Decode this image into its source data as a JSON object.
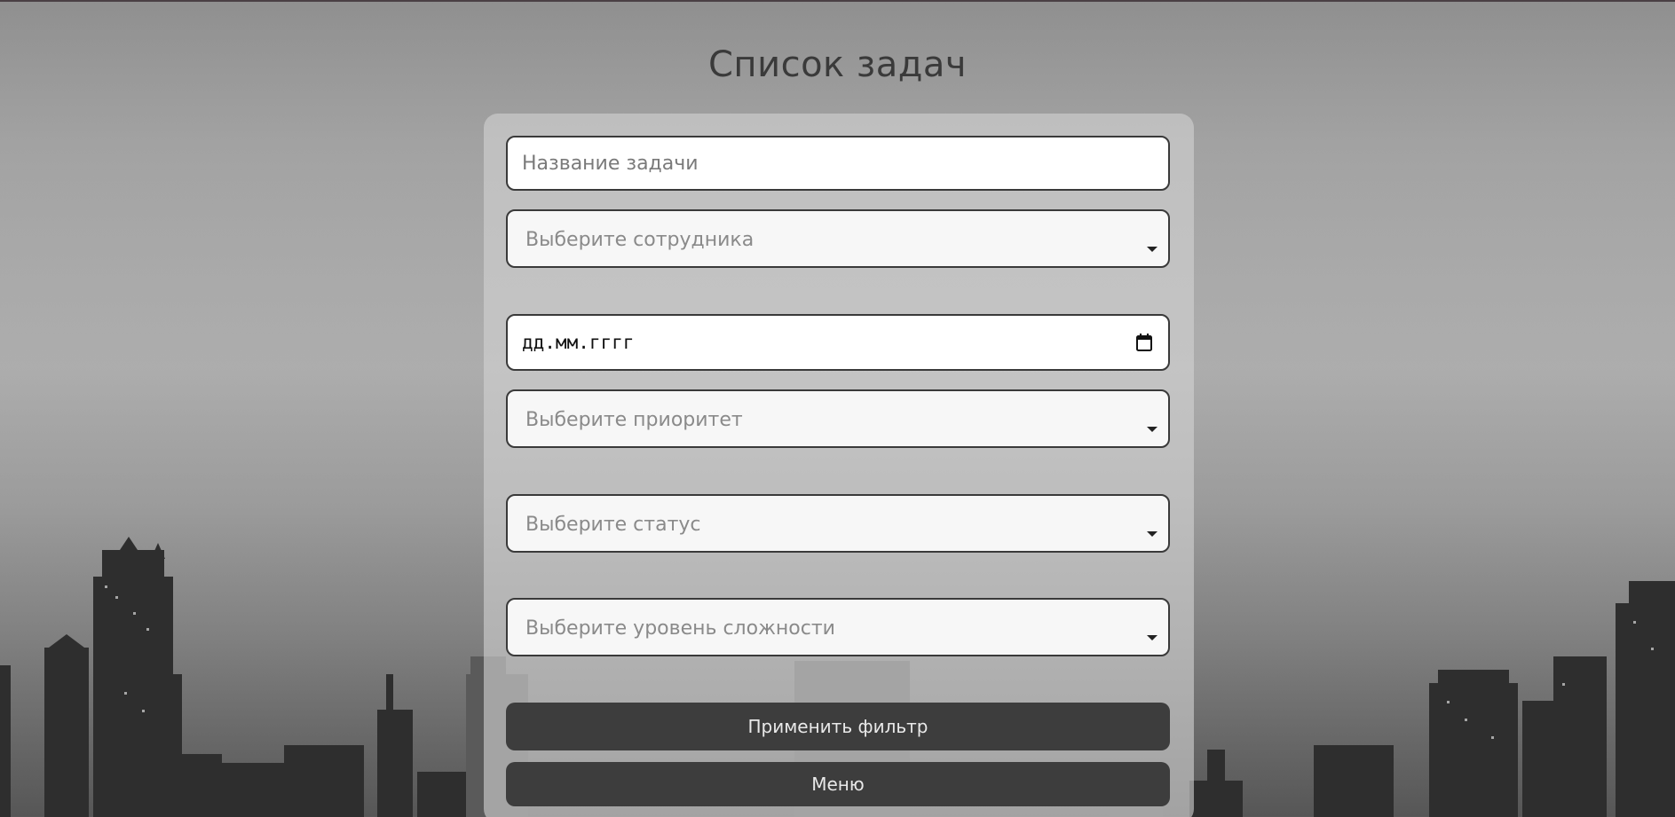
{
  "page": {
    "title": "Список задач"
  },
  "form": {
    "task_name_placeholder": "Название задачи",
    "employee_select": "Выберите сотрудника",
    "date_placeholder": "дд.мм.гггг",
    "priority_select": "Выберите приоритет",
    "status_select": "Выберите статус",
    "difficulty_select": "Выберите уровень сложности"
  },
  "buttons": {
    "apply_filter": "Применить фильтр",
    "menu": "Меню"
  },
  "icons": {
    "date": "calendar-icon",
    "select": "chevron-down-icon"
  },
  "colors": {
    "button_bg": "#3d3d3d",
    "field_border": "#3a3a3a"
  }
}
